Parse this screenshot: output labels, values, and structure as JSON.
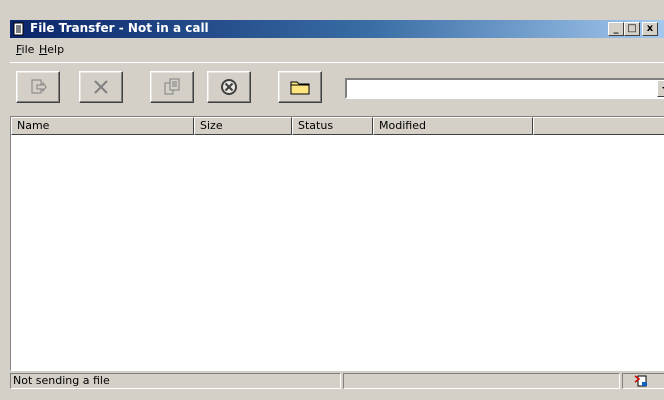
{
  "window": {
    "title": "File Transfer - Not in a call",
    "minimize_glyph": "_",
    "maximize_glyph": "□",
    "close_glyph": "x"
  },
  "menu": {
    "items": [
      {
        "label_rest": "ile",
        "accel": "F"
      },
      {
        "label_rest": "elp",
        "accel": "H"
      }
    ]
  },
  "toolbar": {
    "buttons": [
      {
        "name": "send-file",
        "icon": "send-file-icon",
        "enabled": false
      },
      {
        "name": "stop-sending",
        "icon": "x-icon",
        "enabled": false
      },
      {
        "name": "copy-files",
        "icon": "copy-files-icon",
        "enabled": false
      },
      {
        "name": "cancel-transfer",
        "icon": "cancel-circle-icon",
        "enabled": true
      },
      {
        "name": "open-folder",
        "icon": "folder-icon",
        "enabled": true
      }
    ],
    "recipient_value": ""
  },
  "list": {
    "columns": [
      "Name",
      "Size",
      "Status",
      "Modified",
      ""
    ],
    "rows": []
  },
  "status": {
    "text": "Not sending a file",
    "secondary": ""
  },
  "colors": {
    "title_gradient_start": "#0a246a",
    "title_gradient_end": "#a6caf0",
    "face": "#d4d0c8",
    "folder_yellow": "#ffe680"
  }
}
